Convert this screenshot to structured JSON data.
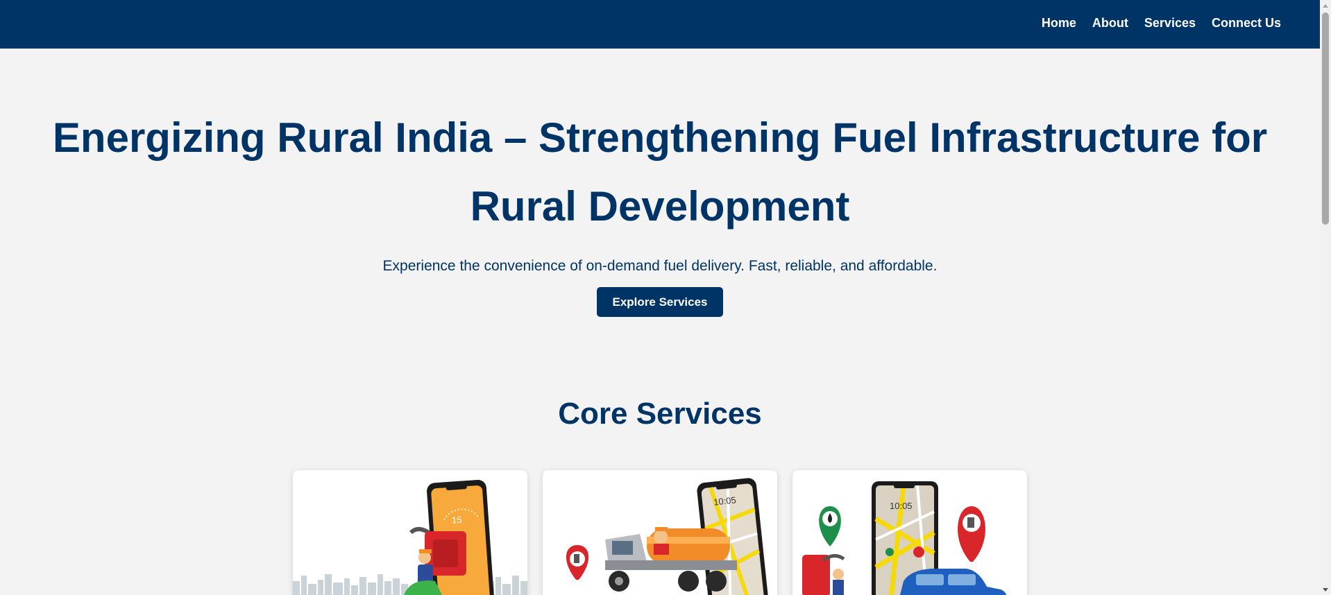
{
  "nav": {
    "items": [
      {
        "label": "Home"
      },
      {
        "label": "About"
      },
      {
        "label": "Services"
      },
      {
        "label": "Connect Us"
      }
    ]
  },
  "hero": {
    "title": "Energizing Rural India – Strengthening Fuel Infrastructure for Rural Development",
    "subtitle": "Experience the convenience of on-demand fuel delivery. Fast, reliable, and affordable.",
    "button_label": "Explore Services"
  },
  "services": {
    "title": "Core Services",
    "cards": [
      {
        "illustration": "scooter-fuel-delivery-illustration",
        "phone_badge": "15"
      },
      {
        "illustration": "fuel-tanker-truck-illustration",
        "phone_time": "10:05"
      },
      {
        "illustration": "map-fuel-locator-illustration",
        "phone_time": "10:05"
      }
    ]
  },
  "colors": {
    "primary": "#003366",
    "background": "#f3f3f3",
    "card": "#ffffff",
    "accent_red": "#d9262b",
    "accent_orange": "#f28c28",
    "accent_yellow": "#f5d90a",
    "accent_green": "#1e8f4a",
    "accent_blue": "#1f5fbf"
  }
}
